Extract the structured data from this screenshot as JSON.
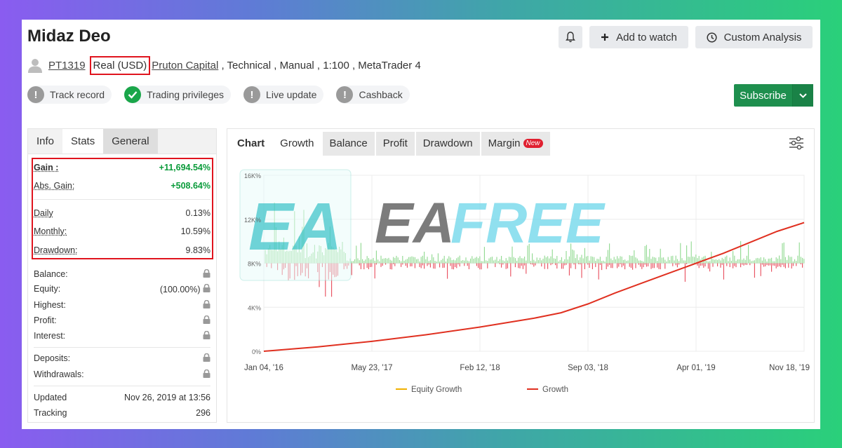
{
  "header": {
    "title": "Midaz Deo",
    "bell_icon": "bell-icon",
    "add_watch_label": "Add to watch",
    "custom_analysis_label": "Custom Analysis"
  },
  "meta": {
    "account_id": "PT1319",
    "account_type": "Real (USD)",
    "broker": "Pruton Capital",
    "rest": " , Technical , Manual , 1:100 , MetaTrader 4"
  },
  "badges": [
    {
      "label": "Track record",
      "status": "grey"
    },
    {
      "label": "Trading privileges",
      "status": "green"
    },
    {
      "label": "Live update",
      "status": "grey"
    },
    {
      "label": "Cashback",
      "status": "grey"
    }
  ],
  "subscribe_label": "Subscribe",
  "left_tabs": [
    "Info",
    "Stats",
    "General"
  ],
  "stats": {
    "gain_label": "Gain :",
    "gain_value": "+11,694.54%",
    "abs_gain_label": "Abs. Gain:",
    "abs_gain_value": "+508.64%",
    "daily_label": "Daily",
    "daily_value": "0.13%",
    "monthly_label": "Monthly:",
    "monthly_value": "10.59%",
    "drawdown_label": "Drawdown:",
    "drawdown_value": "9.83%",
    "balance_label": "Balance:",
    "equity_label": "Equity:",
    "equity_value": "(100.00%)",
    "highest_label": "Highest:",
    "profit_label": "Profit:",
    "interest_label": "Interest:",
    "deposits_label": "Deposits:",
    "withdrawals_label": "Withdrawals:",
    "updated_label": "Updated",
    "updated_value": "Nov 26, 2019 at 13:56",
    "tracking_label": "Tracking",
    "tracking_value": "296"
  },
  "chart_tabs": {
    "chart": "Chart",
    "growth": "Growth",
    "balance": "Balance",
    "profit": "Profit",
    "drawdown": "Drawdown",
    "margin": "Margin",
    "new_badge": "New"
  },
  "watermark": {
    "logo_text": "EA",
    "text_left": "EA",
    "text_right": "FREE"
  },
  "chart_data": {
    "type": "line",
    "y_tick_labels": [
      "0%",
      "4K%",
      "8K%",
      "12K%",
      "16K%"
    ],
    "ylim": [
      0,
      16000
    ],
    "x_tick_labels": [
      "Jan 04, '16",
      "May 23, '17",
      "Feb 12, '18",
      "Sep 03, '18",
      "Apr 01, '19",
      "Nov 18, '19"
    ],
    "grid": true,
    "legend": "bottom",
    "series": [
      {
        "name": "Equity Growth",
        "color": "#f0b000"
      },
      {
        "name": "Growth",
        "color": "#e03020",
        "points": [
          [
            0,
            0
          ],
          [
            0.1,
            400
          ],
          [
            0.2,
            900
          ],
          [
            0.3,
            1500
          ],
          [
            0.4,
            2200
          ],
          [
            0.5,
            3000
          ],
          [
            0.55,
            3500
          ],
          [
            0.6,
            4300
          ],
          [
            0.65,
            5300
          ],
          [
            0.7,
            6200
          ],
          [
            0.75,
            7100
          ],
          [
            0.8,
            8000
          ],
          [
            0.85,
            8900
          ],
          [
            0.9,
            9900
          ],
          [
            0.95,
            10900
          ],
          [
            1,
            11700
          ]
        ]
      }
    ],
    "bar_series": {
      "name": "daily profit/loss",
      "baseline": 8000,
      "positive_color": "#8fd88f",
      "negative_color": "#e84a5a"
    }
  }
}
